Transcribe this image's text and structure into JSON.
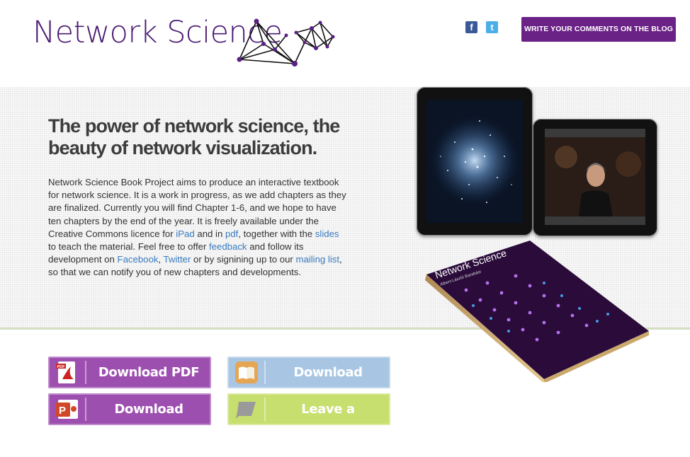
{
  "header": {
    "logo_text": "Network Science",
    "facebook_icon": "facebook-icon",
    "twitter_icon": "twitter-icon",
    "blog_button": "WRITE YOUR COMMENTS ON THE BLOG"
  },
  "hero": {
    "headline": "The power of network science, the beauty of network visualization.",
    "intro": {
      "t1": "Network Science Book Project aims to produce an interactive textbook for network science. It is a work in progress, as we add chapters as they are finalized. Currently you will find Chapter 1-6, and we hope to have ten chapters by the end of the year. It is freely available under the Creative Commons licence for ",
      "link_ipad": "iPad",
      "t2": " and in ",
      "link_pdf": "pdf",
      "t3": ", together with the ",
      "link_slides": "slides",
      "t4": " to teach the material. Feel free to offer ",
      "link_feedback": "feedback",
      "t5": " and follow its development on ",
      "link_facebook": "Facebook",
      "t6": ", ",
      "link_twitter": "Twitter",
      "t7": " or by signining up to our ",
      "link_mailing": "mailing list",
      "t8": ", so that we can notify you of new chapters and developments."
    },
    "book_cover": {
      "title": "Network Science",
      "subtitle": "Albert-László Barabási"
    }
  },
  "downloads": [
    {
      "label": "Download PDF",
      "icon": "pdf-icon",
      "color": "#9d4fb0"
    },
    {
      "label": "Download ibooks",
      "icon": "ibooks-icon",
      "color": "#a8c6e3"
    },
    {
      "label": "Download SLIDES",
      "icon": "powerpoint-icon",
      "color": "#9d4fb0"
    },
    {
      "label": "Leave a Comment",
      "icon": "comment-icon",
      "color": "#c7df6e"
    }
  ],
  "colors": {
    "brand_purple": "#4b1a73",
    "button_purple": "#6b2286",
    "link_blue": "#3a7bc0"
  }
}
